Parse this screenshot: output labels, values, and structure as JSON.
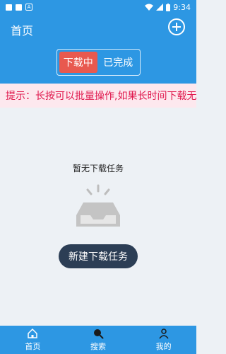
{
  "status_bar": {
    "time": "9:34",
    "a_badge": "A",
    "icons": [
      "notification-square-icon",
      "notification-square-icon",
      "a-badge-icon",
      "wifi-icon",
      "signal-icon",
      "battery-icon"
    ]
  },
  "header": {
    "title": "首页",
    "add_icon": "plus-circle-icon"
  },
  "tabs": [
    {
      "label": "下载中",
      "active": true
    },
    {
      "label": "已完成",
      "active": false
    }
  ],
  "tip": {
    "text": "提示：长按可以批量操作,如果长时间下载无"
  },
  "empty_state": {
    "title": "暂无下载任务",
    "icon": "empty-inbox-icon",
    "button_label": "新建下载任务"
  },
  "bottom_nav": [
    {
      "label": "首页",
      "icon": "home-icon"
    },
    {
      "label": "搜索",
      "icon": "search-icon"
    },
    {
      "label": "我的",
      "icon": "user-icon"
    }
  ],
  "colors": {
    "primary": "#2d97e3",
    "active_tab": "#e8594f",
    "tip_bg": "#fde8ee",
    "tip_text": "#e0184d",
    "button_dark": "#2c3e55",
    "background": "#edf1f5"
  }
}
